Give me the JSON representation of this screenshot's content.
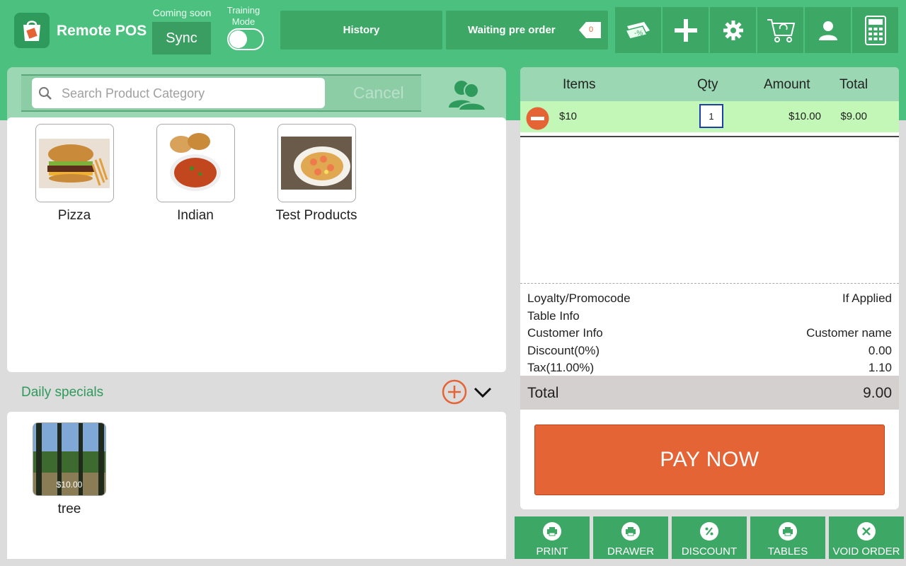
{
  "app": {
    "title": "Remote POS",
    "coming_soon": "Coming soon",
    "sync_label": "Sync",
    "training_mode_label": "Training Mode",
    "training_mode_on": false
  },
  "topbar": {
    "history_label": "History",
    "waiting_preorder_label": "Waiting pre order",
    "waiting_count": "0",
    "icons": [
      "discount-tag-icon",
      "plus-icon",
      "gear-icon",
      "cart-icon",
      "user-icon",
      "calculator-icon"
    ]
  },
  "search": {
    "placeholder": "Search Product Category",
    "value": "",
    "cancel_label": "Cancel"
  },
  "categories": [
    {
      "label": "Pizza",
      "icon": "burger-image"
    },
    {
      "label": "Indian",
      "icon": "curry-image"
    },
    {
      "label": "Test Products",
      "icon": "shrimp-plate-image"
    }
  ],
  "daily_specials": {
    "title": "Daily specials",
    "items": [
      {
        "label": "tree",
        "price": "$10.00"
      }
    ]
  },
  "order": {
    "headers": {
      "items": "Items",
      "qty": "Qty",
      "amount": "Amount",
      "total": "Total"
    },
    "rows": [
      {
        "name": "$10",
        "qty": "1",
        "amount": "$10.00",
        "total": "$9.00"
      }
    ],
    "summary": {
      "loyalty_label": "Loyalty/Promocode",
      "loyalty_value": "If Applied",
      "table_label": "Table Info",
      "customer_label": "Customer Info",
      "customer_value": "Customer name",
      "discount_label": "Discount(0%)",
      "discount_value": "0.00",
      "tax_label": "Tax(11.00%)",
      "tax_value": "1.10"
    },
    "total_label": "Total",
    "total_value": "9.00",
    "pay_label": "PAY NOW"
  },
  "actions": [
    {
      "label": "PRINT",
      "icon": "printer-icon"
    },
    {
      "label": "DRAWER",
      "icon": "drawer-icon"
    },
    {
      "label": "DISCOUNT",
      "icon": "percent-icon"
    },
    {
      "label": "TABLES",
      "icon": "tables-icon"
    },
    {
      "label": "VOID ORDER",
      "icon": "close-icon"
    }
  ],
  "colors": {
    "brand_green": "#4cc17f",
    "dark_green": "#3da866",
    "panel_green": "#9bd7b3",
    "row_highlight": "#c3f7b7",
    "accent_orange": "#e46436"
  }
}
